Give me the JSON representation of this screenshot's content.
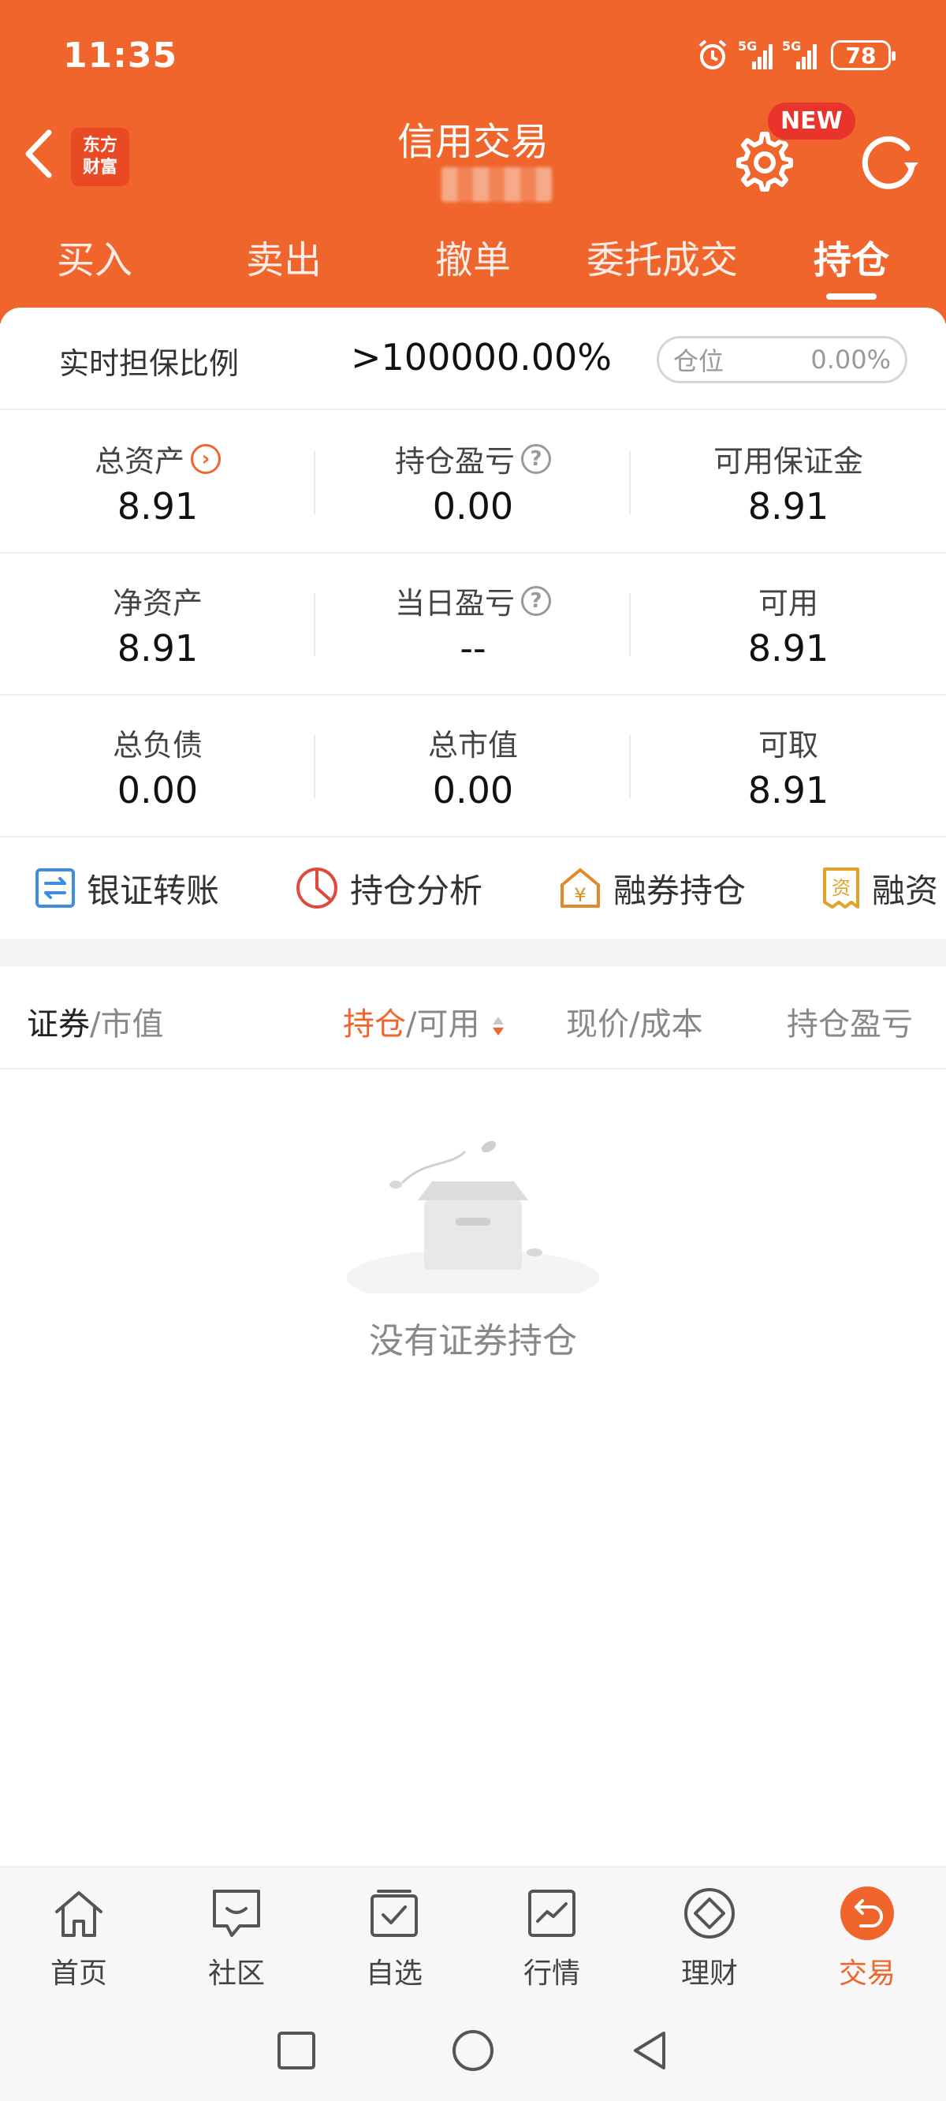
{
  "status": {
    "time": "11:35",
    "battery": "78",
    "net1": "5G",
    "net2": "5G"
  },
  "header": {
    "logo_line1": "东方",
    "logo_line2": "财富",
    "title": "信用交易",
    "badge": "NEW"
  },
  "tabs": [
    {
      "label": "买入"
    },
    {
      "label": "卖出"
    },
    {
      "label": "撤单"
    },
    {
      "label": "委托成交"
    },
    {
      "label": "持仓"
    }
  ],
  "ratio": {
    "label": "实时担保比例",
    "value": ">100000.00%",
    "position_label": "仓位",
    "position_value": "0.00%"
  },
  "grid": [
    [
      {
        "label": "总资产",
        "value": "8.91"
      },
      {
        "label": "持仓盈亏",
        "value": "0.00"
      },
      {
        "label": "可用保证金",
        "value": "8.91"
      }
    ],
    [
      {
        "label": "净资产",
        "value": "8.91"
      },
      {
        "label": "当日盈亏",
        "value": "--"
      },
      {
        "label": "可用",
        "value": "8.91"
      }
    ],
    [
      {
        "label": "总负债",
        "value": "0.00"
      },
      {
        "label": "总市值",
        "value": "0.00"
      },
      {
        "label": "可取",
        "value": "8.91"
      }
    ]
  ],
  "shortcuts": [
    {
      "label": "银证转账",
      "icon": "transfer-icon",
      "color": "#3d8de0"
    },
    {
      "label": "持仓分析",
      "icon": "pie-chart-icon",
      "color": "#e04a3a"
    },
    {
      "label": "融券持仓",
      "icon": "yen-house-icon",
      "color": "#e08a2a"
    },
    {
      "label": "融资",
      "icon": "receipt-icon",
      "color": "#e0a32a"
    }
  ],
  "table_header": {
    "col1_a": "证券",
    "col1_b": "/市值",
    "col2_a": "持仓",
    "col2_b": "/可用",
    "col3": "现价/成本",
    "col4": "持仓盈亏"
  },
  "empty_text": "没有证券持仓",
  "bottom_nav": [
    {
      "label": "首页",
      "icon": "home-icon"
    },
    {
      "label": "社区",
      "icon": "chat-icon"
    },
    {
      "label": "自选",
      "icon": "checkbox-icon"
    },
    {
      "label": "行情",
      "icon": "line-chart-icon"
    },
    {
      "label": "理财",
      "icon": "diamond-icon"
    },
    {
      "label": "交易",
      "icon": "trade-icon"
    }
  ],
  "colors": {
    "brand": "#ef652b"
  }
}
